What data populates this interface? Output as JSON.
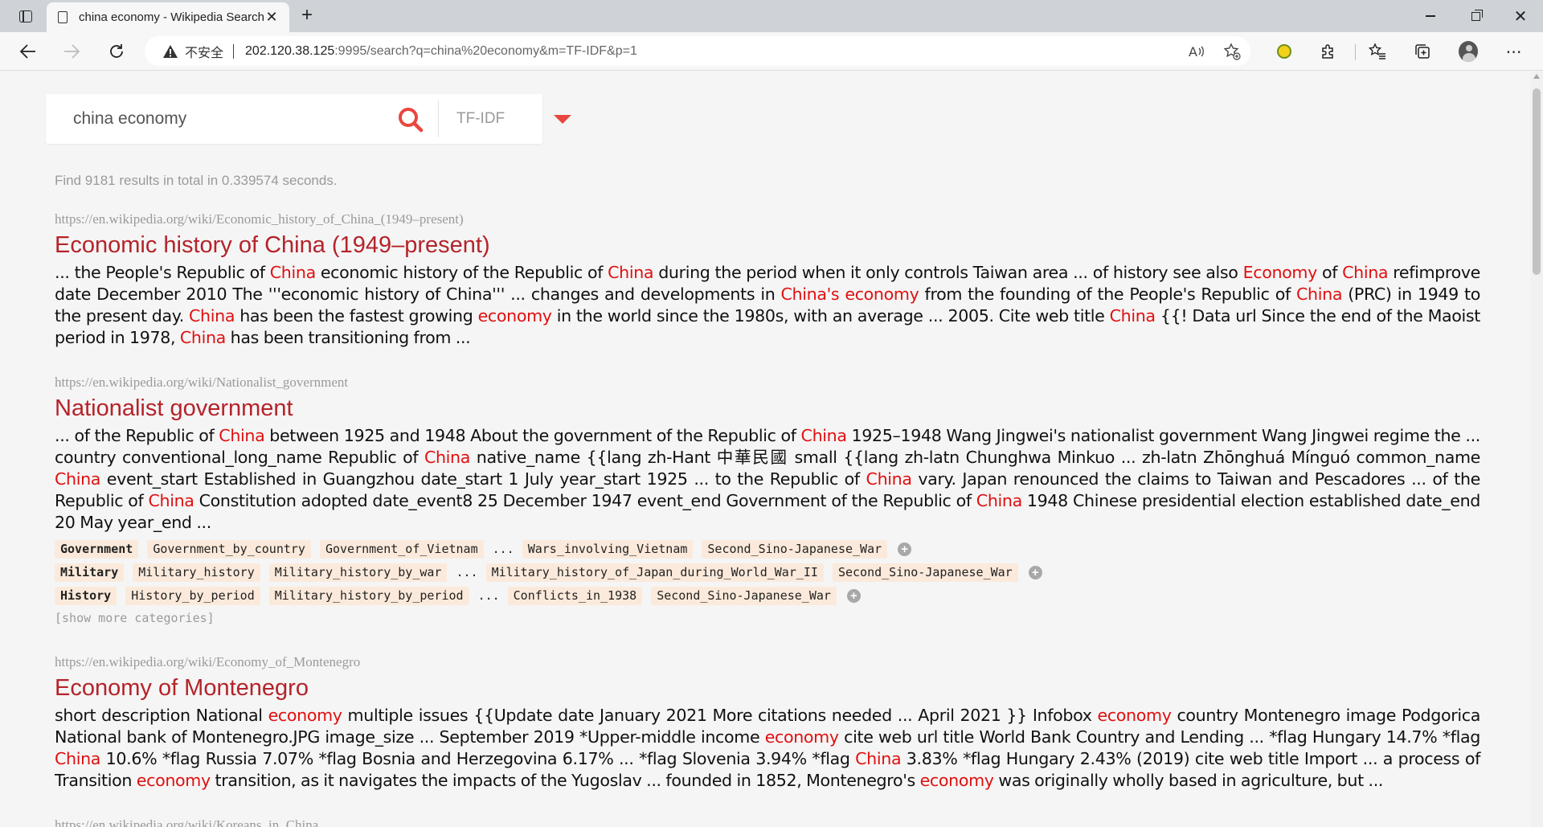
{
  "browser": {
    "tab_title": "china economy - Wikipedia Search",
    "insecure_label": "不安全",
    "url_host": "202.120.38.125",
    "url_rest": ":9995/search?q=china%20economy&m=TF-IDF&p=1"
  },
  "search": {
    "query": "china economy",
    "mode": "TF-IDF",
    "accent_color": "#e8473f"
  },
  "stats": "Find 9181 results in total in 0.339574 seconds.",
  "results": [
    {
      "url": "https://en.wikipedia.org/wiki/Economic_history_of_China_(1949–present)",
      "title": "Economic history of China (1949–present)",
      "snippet": [
        {
          "t": "... the People's Republic of "
        },
        {
          "t": "China",
          "hl": true
        },
        {
          "t": " economic history of the Republic of "
        },
        {
          "t": "China",
          "hl": true
        },
        {
          "t": " during the period when it only controls Taiwan area ... of history see also "
        },
        {
          "t": "Economy",
          "hl": true
        },
        {
          "t": " of "
        },
        {
          "t": "China",
          "hl": true
        },
        {
          "t": " refimprove date December 2010 The '''economic history of China''' ... changes and developments in "
        },
        {
          "t": "China's economy",
          "hl": true
        },
        {
          "t": " from the founding of the People's Republic of "
        },
        {
          "t": "China",
          "hl": true
        },
        {
          "t": " (PRC) in 1949 to the present day. "
        },
        {
          "t": "China",
          "hl": true
        },
        {
          "t": " has been the fastest growing "
        },
        {
          "t": "economy",
          "hl": true
        },
        {
          "t": " in the world since the 1980s, with an average ... 2005. Cite web title "
        },
        {
          "t": "China",
          "hl": true
        },
        {
          "t": " {{! Data url Since the end of the Maoist period in 1978, "
        },
        {
          "t": "China",
          "hl": true
        },
        {
          "t": " has been transitioning from ..."
        }
      ]
    },
    {
      "url": "https://en.wikipedia.org/wiki/Nationalist_government",
      "title": "Nationalist government",
      "snippet": [
        {
          "t": "... of the Republic of "
        },
        {
          "t": "China",
          "hl": true
        },
        {
          "t": " between 1925 and 1948 About the government of the Republic of "
        },
        {
          "t": "China",
          "hl": true
        },
        {
          "t": " 1925–1948 Wang Jingwei's nationalist government Wang Jingwei regime the ... country conventional_long_name Republic of "
        },
        {
          "t": "China",
          "hl": true
        },
        {
          "t": " native_name {{lang zh-Hant 中華民國 small {{lang zh-latn Chunghwa Minkuo ... zh-latn Zhōnghuá Mínguó common_name "
        },
        {
          "t": "China",
          "hl": true
        },
        {
          "t": " event_start Established in Guangzhou date_start 1 July year_start 1925 ... to the Republic of "
        },
        {
          "t": "China",
          "hl": true
        },
        {
          "t": " vary. Japan renounced the claims to Taiwan and Pescadores ... of the Republic of "
        },
        {
          "t": "China",
          "hl": true
        },
        {
          "t": " Constitution adopted date_event8 25 December 1947 event_end Government of the Republic of "
        },
        {
          "t": "China",
          "hl": true
        },
        {
          "t": " 1948 Chinese presidential election established date_end 20 May year_end ..."
        }
      ],
      "categories": [
        {
          "head": "Government",
          "items": [
            "Government_by_country",
            "Government_of_Vietnam"
          ],
          "tail": [
            "Wars_involving_Vietnam",
            "Second_Sino-Japanese_War"
          ]
        },
        {
          "head": "Military",
          "items": [
            "Military_history",
            "Military_history_by_war"
          ],
          "tail": [
            "Military_history_of_Japan_during_World_War_II",
            "Second_Sino-Japanese_War"
          ]
        },
        {
          "head": "History",
          "items": [
            "History_by_period",
            "Military_history_by_period"
          ],
          "tail": [
            "Conflicts_in_1938",
            "Second_Sino-Japanese_War"
          ]
        }
      ],
      "ellipsis": "...",
      "plus": "+",
      "show_more": "[show more categories]"
    },
    {
      "url": "https://en.wikipedia.org/wiki/Economy_of_Montenegro",
      "title": "Economy of Montenegro",
      "snippet": [
        {
          "t": "short description National "
        },
        {
          "t": "economy",
          "hl": true
        },
        {
          "t": " multiple issues {{Update date January 2021 More citations needed ... April 2021 }} Infobox "
        },
        {
          "t": "economy",
          "hl": true
        },
        {
          "t": " country Montenegro image Podgorica National bank of Montenegro.JPG image_size ... September 2019 *Upper-middle income "
        },
        {
          "t": "economy",
          "hl": true
        },
        {
          "t": " cite web url title World Bank Country and Lending ... *flag Hungary 14.7% *flag "
        },
        {
          "t": "China",
          "hl": true
        },
        {
          "t": " 10.6% *flag Russia 7.07% *flag Bosnia and Herzegovina 6.17% ... *flag Slovenia 3.94% *flag "
        },
        {
          "t": "China",
          "hl": true
        },
        {
          "t": " 3.83% *flag Hungary 2.43% (2019) cite web title Import ... a process of Transition "
        },
        {
          "t": "economy",
          "hl": true
        },
        {
          "t": " transition, as it navigates the impacts of the Yugoslav ... founded in 1852, Montenegro's "
        },
        {
          "t": "economy",
          "hl": true
        },
        {
          "t": " was originally wholly based in agriculture, but ..."
        }
      ]
    },
    {
      "url": "https://en.wikipedia.org/wiki/Koreans_in_China"
    }
  ],
  "colors": {
    "title": "#b5232a",
    "highlight": "#e01010",
    "chip_bg": "#fbeadb",
    "muted": "#9a9a9a"
  }
}
